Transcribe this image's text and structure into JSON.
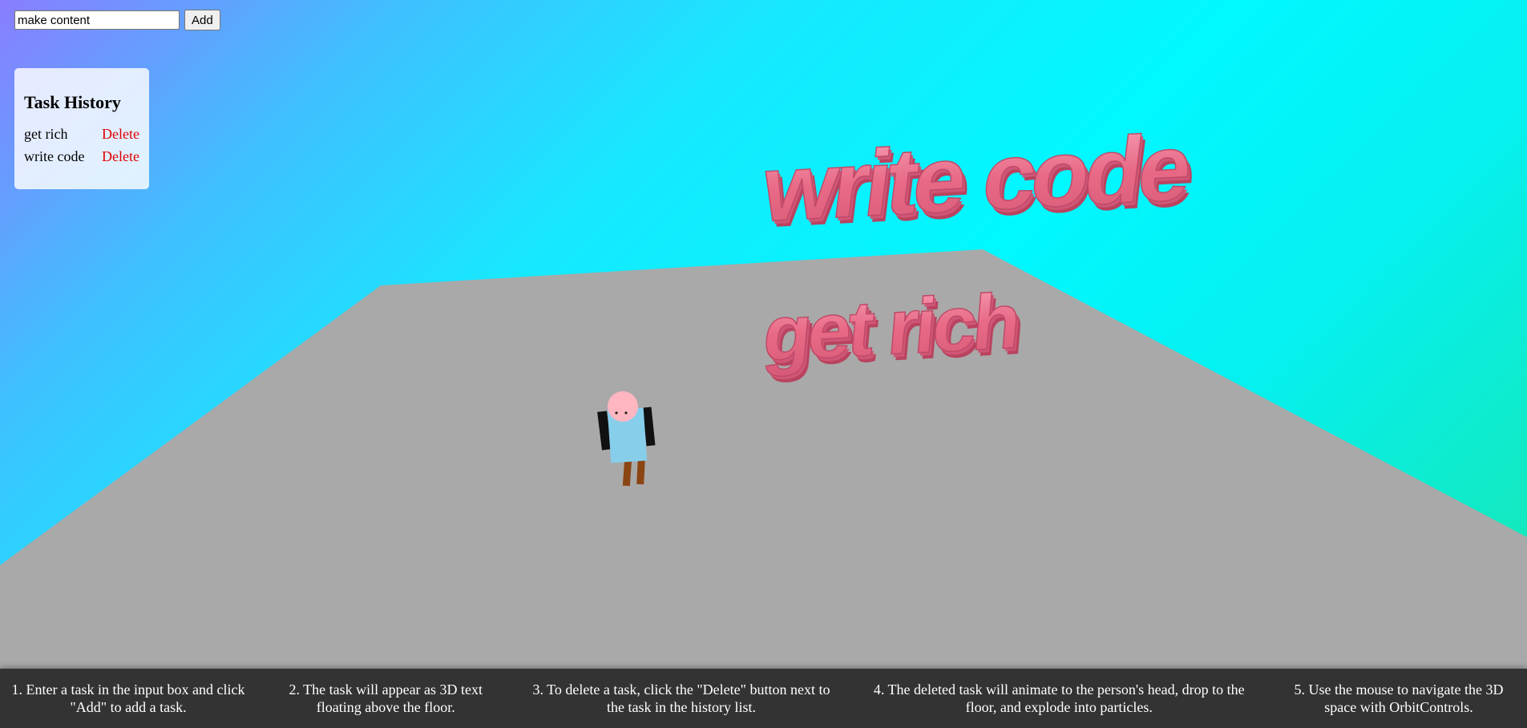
{
  "form": {
    "input_value": "make content",
    "add_label": "Add"
  },
  "history": {
    "title": "Task History",
    "items": [
      {
        "label": "get rich",
        "delete_label": "Delete"
      },
      {
        "label": "write code",
        "delete_label": "Delete"
      }
    ]
  },
  "scene": {
    "floating_texts": [
      "write code",
      "get rich"
    ],
    "colors": {
      "text": "#e86a86",
      "text_shade": "#b9435f",
      "floor": "#a9a9a9",
      "head": "#ffb6c1",
      "body": "#87ceeb",
      "arms": "#111111",
      "legs": "#8b4513"
    }
  },
  "instructions": [
    "1. Enter a task in the input box and click \"Add\" to add a task.",
    "2. The task will appear as 3D text floating above the floor.",
    "3. To delete a task, click the \"Delete\" button next to the task in the history list.",
    "4. The deleted task will animate to the person's head, drop to the floor, and explode into particles.",
    "5. Use the mouse to navigate the 3D space with OrbitControls."
  ]
}
